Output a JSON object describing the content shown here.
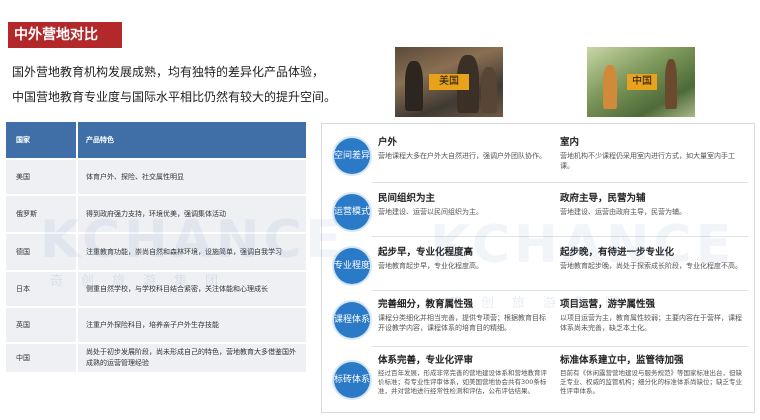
{
  "header": {
    "title": "中外营地对比"
  },
  "intro": {
    "line1": "国外营地教育机构发展成熟，均有独特的差异化产品体验，",
    "line2": "中国营地教育专业度与国际水平相比仍然有较大的提升空间。"
  },
  "photos": [
    {
      "label": "美国"
    },
    {
      "label": "中国"
    }
  ],
  "left_table": {
    "headers": [
      "国家",
      "产品特色"
    ],
    "rows": [
      {
        "country": "美国",
        "feature": "体育户外、探险、社交属性明显"
      },
      {
        "country": "俄罗斯",
        "feature": "得到政府强力支持，环境优美，强调集体活动"
      },
      {
        "country": "德国",
        "feature": "注重教育功能，崇尚自然和森林环境，设施简单，强调自我学习"
      },
      {
        "country": "日本",
        "feature": "侧重自然学校，与学校科目结合紧密，关注体能和心理成长"
      },
      {
        "country": "英国",
        "feature": "注重户外探险科目，培养亲子户外生存技能"
      },
      {
        "country": "中国",
        "feature": "尚处于初步发展阶段，尚未形成自己的特色，营地教育大多借鉴国外成熟的运营管理经验"
      }
    ]
  },
  "comparison": [
    {
      "badge": "空间差异",
      "left_title": "户外",
      "left_text": "营地课程大多在户外大自然进行，强调户外团队协作。",
      "right_title": "室内",
      "right_text": "营地机构不少课程仍采用室内进行方式，如大量室内手工课。"
    },
    {
      "badge": "运营模式",
      "left_title": "民间组织为主",
      "left_text": "营地建设、运营以民间组织为主。",
      "right_title": "政府主导，民营为辅",
      "right_text": "营地建设、运营由政府主导，民营为辅。"
    },
    {
      "badge": "专业程度",
      "left_title": "起步早，专业化程度高",
      "left_text": "营地教育起步早，专业化程度高。",
      "right_title": "起步晚，有待进一步专业化",
      "right_text": "营地教育起步晚，尚处于探索成长阶段，专业化程度不高。"
    },
    {
      "badge": "课程体系",
      "left_title": "完善细分，教育属性强",
      "left_text": "课程分类细化并相当完善，提供专项营；根据教育目标开设教学内容，课程体系的培育目的精细。",
      "right_title": "项目运营，游学属性强",
      "right_text": "以项目运营为主，教育属性较弱；主要内容在于营样，课程体系尚未完善，缺乏本土化。"
    },
    {
      "badge": "标砖体系",
      "left_title": "体系完善，专业化评审",
      "left_text": "经过百年发展，形成非常完善的营地建设体系和营地教育评价标准；有专业性评审体系，如美国营地协会共有300条标准，并对营地进行经常性检测和评估，公布评估结果。",
      "right_title": "标准体系建立中，监管待加强",
      "right_text": "目前有《休闲露营营地建设与服务规范》等国家标准出台，但缺乏专业、权威的监管机构；细分化的标准体系尚缺位；缺乏专业性评审体系。"
    }
  ],
  "watermark": {
    "brand": "KCHANCE",
    "cn": "奇创旅游集团"
  },
  "colors": {
    "title_bg": "#b2282b",
    "table_head": "#3f6fa6",
    "badge": "#2b7ac7",
    "label_bg": "#e8a21b"
  }
}
